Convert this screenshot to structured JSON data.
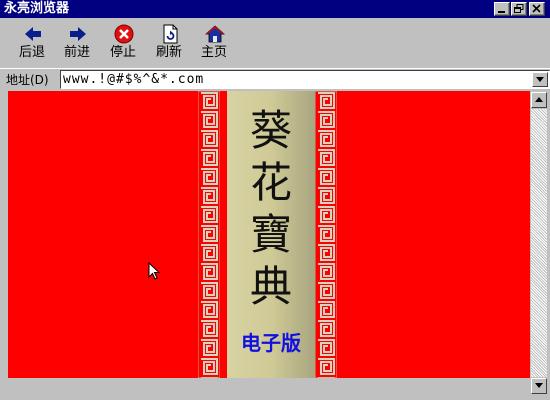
{
  "window": {
    "title": "永亮浏览器"
  },
  "toolbar": {
    "buttons": [
      {
        "label": "后退",
        "icon": "back-arrow-icon"
      },
      {
        "label": "前进",
        "icon": "forward-arrow-icon"
      },
      {
        "label": "停止",
        "icon": "stop-icon"
      },
      {
        "label": "刷新",
        "icon": "refresh-icon"
      },
      {
        "label": "主页",
        "icon": "home-icon"
      }
    ]
  },
  "address": {
    "label": "地址(D)",
    "value": "www.!@#$%^&*.com"
  },
  "content": {
    "title_chars": [
      "葵",
      "花",
      "寶",
      "典"
    ],
    "edition": "电子版"
  },
  "colors": {
    "titlebar": "#000080",
    "page_background": "#ff0000",
    "panel": "#cfca96",
    "edition_text": "#1010e0",
    "arrow_blue": "#0a1e8c",
    "stop_red": "#e01010"
  }
}
